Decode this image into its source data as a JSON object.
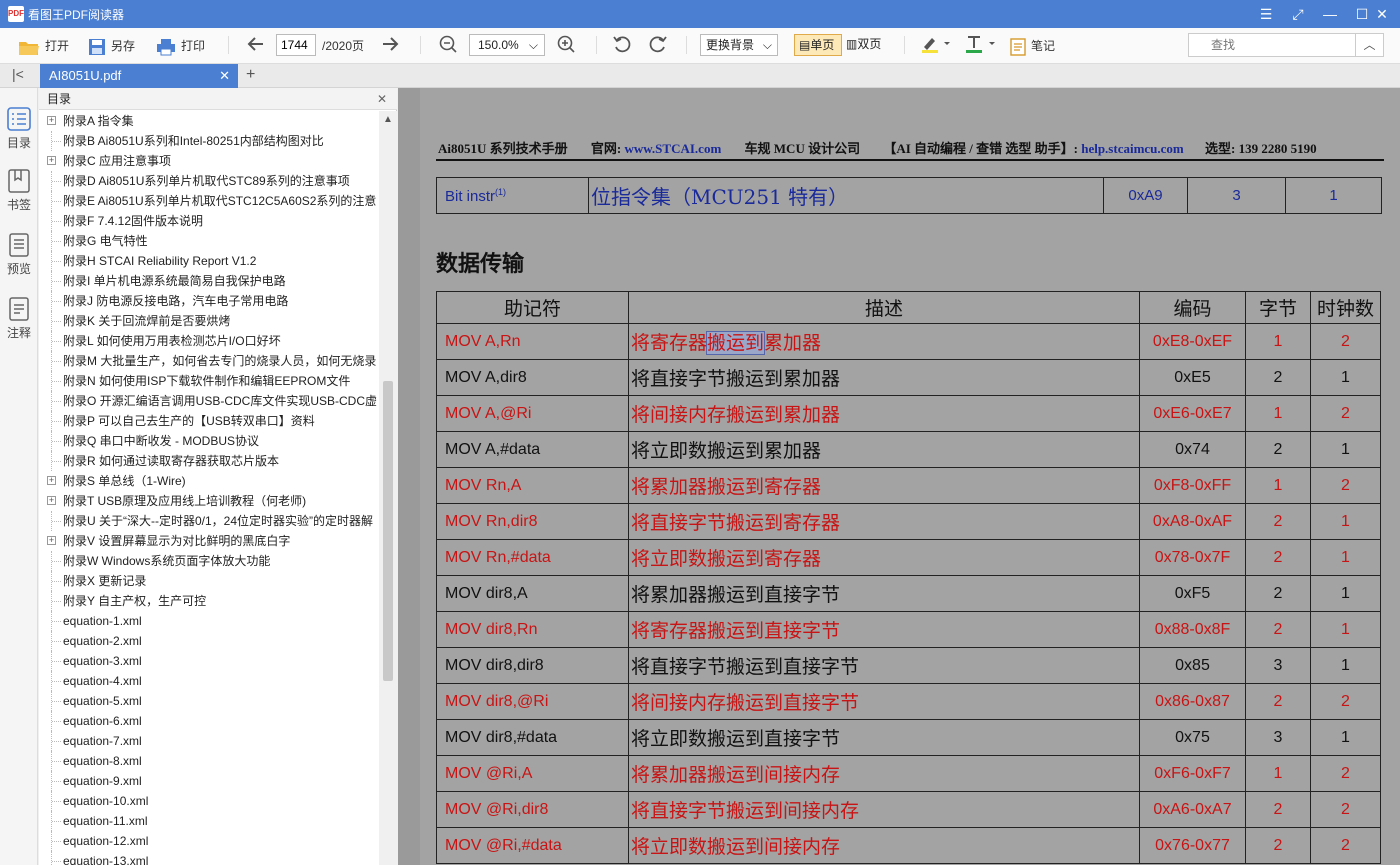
{
  "window": {
    "logo": "PDF",
    "title": "看图王PDF阅读器"
  },
  "toolbar": {
    "open": "打开",
    "save_as": "另存",
    "print": "打印",
    "page_current": "1744",
    "page_total": "/2020页",
    "zoom": "150.0%",
    "background": "更换背景",
    "single": "单页",
    "double": "双页",
    "notes": "笔记",
    "search_placeholder": "查找"
  },
  "tab": {
    "label": "AI8051U.pdf"
  },
  "sidebar": [
    {
      "label": "目录"
    },
    {
      "label": "书签"
    },
    {
      "label": "预览"
    },
    {
      "label": "注释"
    }
  ],
  "toc": {
    "title": "目录",
    "items": [
      {
        "label": "附录A 指令集",
        "expandable": true
      },
      {
        "label": "附录B Ai8051U系列和Intel-80251内部结构图对比",
        "expandable": false
      },
      {
        "label": "附录C 应用注意事项",
        "expandable": true
      },
      {
        "label": "附录D Ai8051U系列单片机取代STC89系列的注意事项",
        "expandable": false
      },
      {
        "label": "附录E Ai8051U系列单片机取代STC12C5A60S2系列的注意",
        "expandable": false
      },
      {
        "label": "附录F 7.4.12固件版本说明",
        "expandable": false
      },
      {
        "label": "附录G 电气特性",
        "expandable": false
      },
      {
        "label": "附录H STCAI Reliability Report V1.2",
        "expandable": false
      },
      {
        "label": "附录I 单片机电源系统最简易自我保护电路",
        "expandable": false
      },
      {
        "label": "附录J 防电源反接电路，汽车电子常用电路",
        "expandable": false
      },
      {
        "label": "附录K 关于回流焊前是否要烘烤",
        "expandable": false
      },
      {
        "label": "附录L 如何使用万用表检测芯片I/O口好坏",
        "expandable": false
      },
      {
        "label": "附录M 大批量生产，如何省去专门的烧录人员，如何无烧录",
        "expandable": false
      },
      {
        "label": "附录N 如何使用ISP下载软件制作和编辑EEPROM文件",
        "expandable": false
      },
      {
        "label": "附录O 开源汇编语言调用USB-CDC库文件实现USB-CDC虚",
        "expandable": false
      },
      {
        "label": "附录P 可以自己去生产的【USB转双串口】资料",
        "expandable": false
      },
      {
        "label": "附录Q 串口中断收发 - MODBUS协议",
        "expandable": false
      },
      {
        "label": "附录R 如何通过读取寄存器获取芯片版本",
        "expandable": false
      },
      {
        "label": "附录S 单总线（1-Wire)",
        "expandable": true
      },
      {
        "label": "附录T USB原理及应用线上培训教程（何老师)",
        "expandable": true
      },
      {
        "label": "附录U 关于“深大--定时器0/1，24位定时器实验”的定时器解",
        "expandable": false
      },
      {
        "label": "附录V 设置屏幕显示为对比鲜明的黑底白字",
        "expandable": true
      },
      {
        "label": "附录W Windows系统页面字体放大功能",
        "expandable": false
      },
      {
        "label": "附录X 更新记录",
        "expandable": false
      },
      {
        "label": "附录Y 自主产权，生产可控",
        "expandable": false
      },
      {
        "label": "equation-1.xml",
        "expandable": false
      },
      {
        "label": "equation-2.xml",
        "expandable": false
      },
      {
        "label": "equation-3.xml",
        "expandable": false
      },
      {
        "label": "equation-4.xml",
        "expandable": false
      },
      {
        "label": "equation-5.xml",
        "expandable": false
      },
      {
        "label": "equation-6.xml",
        "expandable": false
      },
      {
        "label": "equation-7.xml",
        "expandable": false
      },
      {
        "label": "equation-8.xml",
        "expandable": false
      },
      {
        "label": "equation-9.xml",
        "expandable": false
      },
      {
        "label": "equation-10.xml",
        "expandable": false
      },
      {
        "label": "equation-11.xml",
        "expandable": false
      },
      {
        "label": "equation-12.xml",
        "expandable": false
      },
      {
        "label": "equation-13.xml",
        "expandable": false
      }
    ]
  },
  "doc": {
    "header": {
      "series": "Ai8051U 系列技术手册",
      "site_label": "官网:",
      "site": "www.STCAI.com",
      "company": "车规 MCU 设计公司",
      "assist_label": "【AI 自动编程 / 查错 选型 助手】:",
      "assist_site": "help.stcaimcu.com",
      "phone": "选型: 139 2280 5190"
    },
    "bit_row": {
      "mnemonic": "Bit instr",
      "sup": "(1)",
      "desc": "位指令集（MCU251 特有）",
      "code": "0xA9",
      "bytes": "3",
      "cycles": "1"
    },
    "section_title": "数据传输",
    "columns": {
      "mnemonic": "助记符",
      "desc": "描述",
      "code": "编码",
      "bytes": "字节",
      "cycles": "时钟数"
    },
    "highlight_row": 0,
    "highlight": {
      "pre": "将寄存器",
      "mark": "搬运到",
      "post": "累加器"
    },
    "rows": [
      {
        "mnemonic": "MOV A,Rn",
        "desc": "将寄存器搬运到累加器",
        "code": "0xE8-0xEF",
        "bytes": "1",
        "cycles": "2",
        "red": true
      },
      {
        "mnemonic": "MOV A,dir8",
        "desc": "将直接字节搬运到累加器",
        "code": "0xE5",
        "bytes": "2",
        "cycles": "1",
        "red": false
      },
      {
        "mnemonic": "MOV A,@Ri",
        "desc": "将间接内存搬运到累加器",
        "code": "0xE6-0xE7",
        "bytes": "1",
        "cycles": "2",
        "red": true
      },
      {
        "mnemonic": "MOV A,#data",
        "desc": "将立即数搬运到累加器",
        "code": "0x74",
        "bytes": "2",
        "cycles": "1",
        "red": false
      },
      {
        "mnemonic": "MOV Rn,A",
        "desc": "将累加器搬运到寄存器",
        "code": "0xF8-0xFF",
        "bytes": "1",
        "cycles": "2",
        "red": true
      },
      {
        "mnemonic": "MOV Rn,dir8",
        "desc": "将直接字节搬运到寄存器",
        "code": "0xA8-0xAF",
        "bytes": "2",
        "cycles": "1",
        "red": true
      },
      {
        "mnemonic": "MOV Rn,#data",
        "desc": "将立即数搬运到寄存器",
        "code": "0x78-0x7F",
        "bytes": "2",
        "cycles": "1",
        "red": true
      },
      {
        "mnemonic": "MOV dir8,A",
        "desc": "将累加器搬运到直接字节",
        "code": "0xF5",
        "bytes": "2",
        "cycles": "1",
        "red": false
      },
      {
        "mnemonic": "MOV dir8,Rn",
        "desc": "将寄存器搬运到直接字节",
        "code": "0x88-0x8F",
        "bytes": "2",
        "cycles": "1",
        "red": true
      },
      {
        "mnemonic": "MOV dir8,dir8",
        "desc": "将直接字节搬运到直接字节",
        "code": "0x85",
        "bytes": "3",
        "cycles": "1",
        "red": false
      },
      {
        "mnemonic": "MOV dir8,@Ri",
        "desc": "将间接内存搬运到直接字节",
        "code": "0x86-0x87",
        "bytes": "2",
        "cycles": "2",
        "red": true
      },
      {
        "mnemonic": "MOV dir8,#data",
        "desc": "将立即数搬运到直接字节",
        "code": "0x75",
        "bytes": "3",
        "cycles": "1",
        "red": false
      },
      {
        "mnemonic": "MOV @Ri,A",
        "desc": "将累加器搬运到间接内存",
        "code": "0xF6-0xF7",
        "bytes": "1",
        "cycles": "2",
        "red": true
      },
      {
        "mnemonic": "MOV @Ri,dir8",
        "desc": "将直接字节搬运到间接内存",
        "code": "0xA6-0xA7",
        "bytes": "2",
        "cycles": "2",
        "red": true
      },
      {
        "mnemonic": "MOV @Ri,#data",
        "desc": "将立即数搬运到间接内存",
        "code": "0x76-0x77",
        "bytes": "2",
        "cycles": "2",
        "red": true
      }
    ]
  },
  "colors": {
    "accent": "#4a7fd2",
    "red_text": "#c81414",
    "blue_text": "#1a2a9a"
  },
  "icons": [
    "app-logo",
    "open-folder-icon",
    "save-icon",
    "print-icon",
    "arrow-left-icon",
    "arrow-right-icon",
    "zoom-out-icon",
    "zoom-in-icon",
    "rotate-left-icon",
    "rotate-right-icon",
    "highlighter-icon",
    "text-color-icon",
    "note-icon",
    "search-icon"
  ]
}
